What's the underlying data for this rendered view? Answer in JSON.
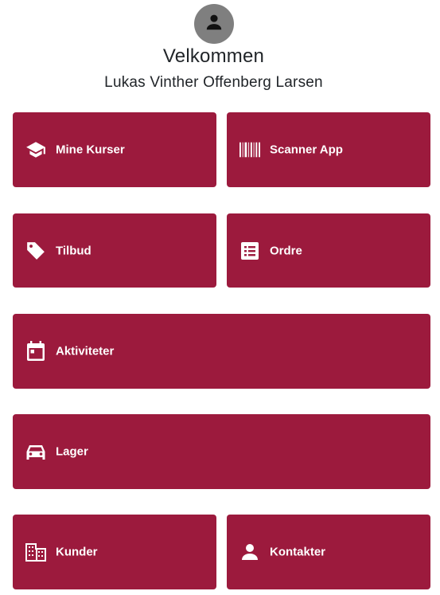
{
  "header": {
    "welcome": "Velkommen",
    "user_name": "Lukas Vinther Offenberg Larsen",
    "avatar_icon": "person-icon"
  },
  "colors": {
    "tile_bg": "#9c1a3d",
    "tile_text": "#ffffff",
    "avatar_bg": "#7f7f7f"
  },
  "tiles": [
    {
      "label": "Mine Kurser",
      "icon": "graduation-cap-icon"
    },
    {
      "label": "Scanner App",
      "icon": "barcode-icon"
    },
    {
      "label": "Tilbud",
      "icon": "tag-icon"
    },
    {
      "label": "Ordre",
      "icon": "list-icon"
    },
    {
      "label": "Aktiviteter",
      "icon": "calendar-icon"
    },
    {
      "label": "Lager",
      "icon": "car-icon"
    },
    {
      "label": "Kunder",
      "icon": "building-icon"
    },
    {
      "label": "Kontakter",
      "icon": "person-icon"
    }
  ]
}
